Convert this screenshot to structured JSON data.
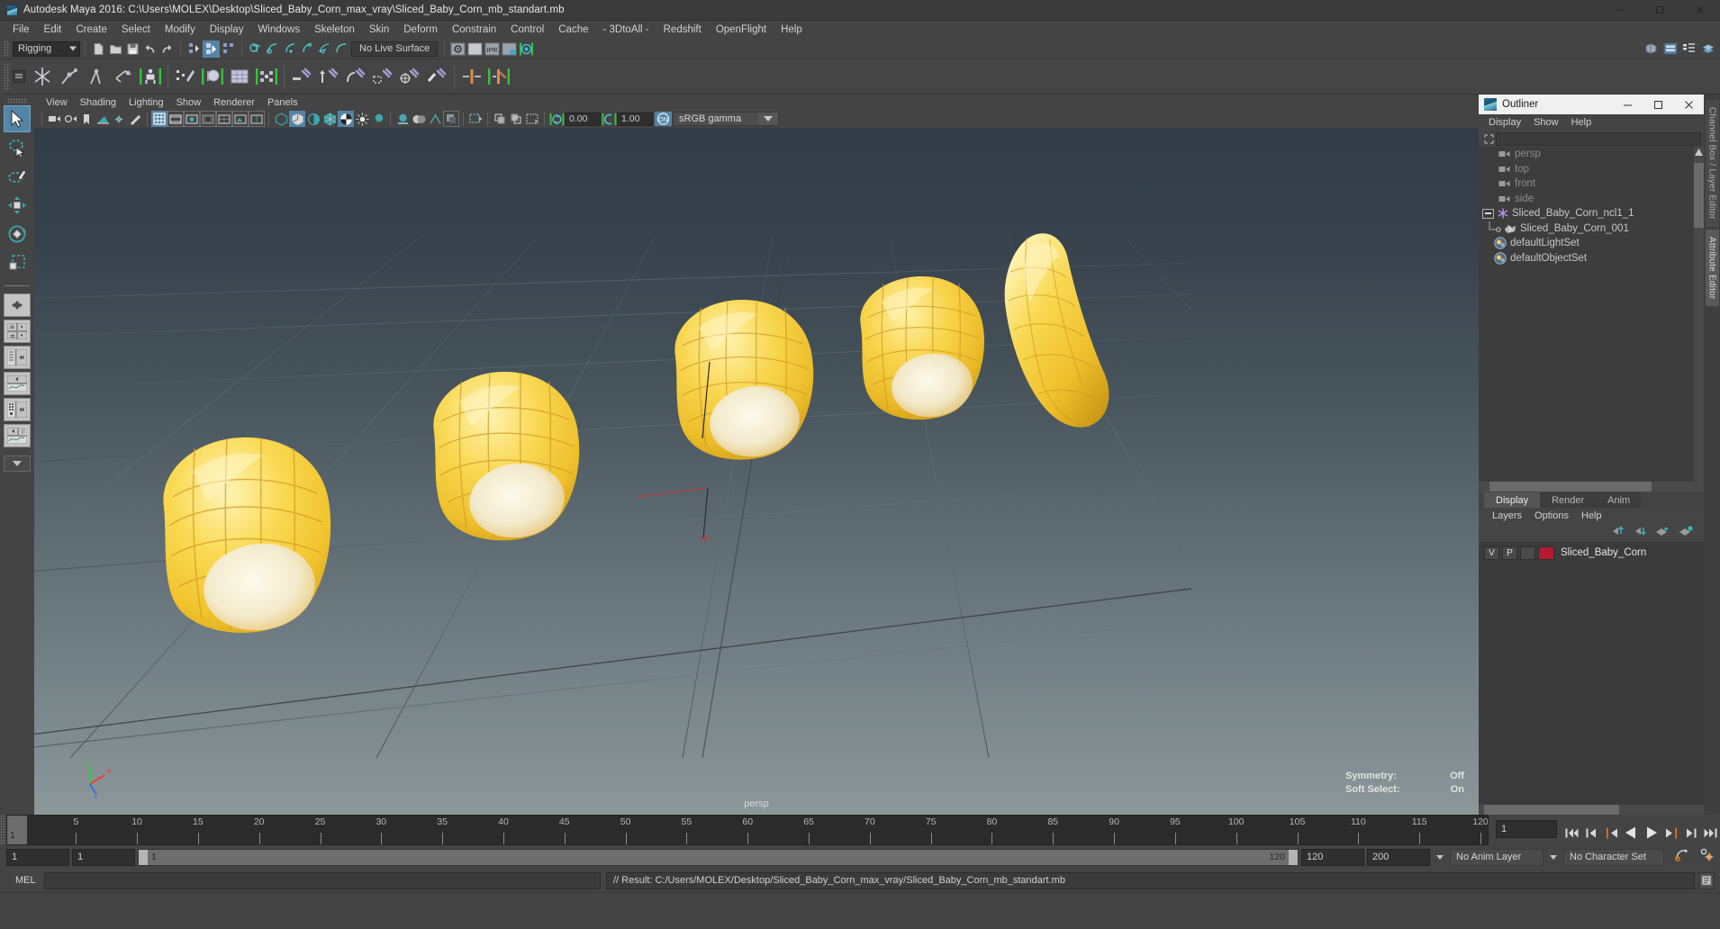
{
  "window": {
    "title": "Autodesk Maya 2016: C:\\Users\\MOLEX\\Desktop\\Sliced_Baby_Corn_max_vray\\Sliced_Baby_Corn_mb_standart.mb",
    "icon": "maya-app-icon",
    "minimize": "minimize-button",
    "maximize": "maximize-button",
    "close": "close-button"
  },
  "menubar": {
    "items": [
      "File",
      "Edit",
      "Create",
      "Select",
      "Modify",
      "Display",
      "Windows",
      "Skeleton",
      "Skin",
      "Deform",
      "Constrain",
      "Control",
      "Cache",
      "- 3DtoAll -",
      "Redshift",
      "OpenFlight",
      "Help"
    ]
  },
  "statusline": {
    "menu_set": "Rigging",
    "live_surface": "No Live Surface"
  },
  "viewport_menu": {
    "items": [
      "View",
      "Shading",
      "Lighting",
      "Show",
      "Renderer",
      "Panels"
    ]
  },
  "viewport_toolbar": {
    "exposure_value": "0.00",
    "gamma_value": "1.00",
    "color_profile": "sRGB gamma",
    "toggle_label": "ON"
  },
  "viewport": {
    "camera_label": "persp",
    "symmetry_label": "Symmetry:",
    "symmetry_value": "Off",
    "soft_select_label": "Soft Select:",
    "soft_select_value": "On",
    "axis": {
      "x": "x",
      "y": "y",
      "z": "z"
    },
    "background_top": "#313c46",
    "background_bottom": "#8b9799"
  },
  "outliner": {
    "title": "Outliner",
    "menu": [
      "Display",
      "Show",
      "Help"
    ],
    "search_value": "",
    "search_placeholder": "",
    "items": [
      {
        "label": "persp",
        "icon": "camera-icon",
        "indent": 22,
        "dim": true
      },
      {
        "label": "top",
        "icon": "camera-icon",
        "indent": 22,
        "dim": true
      },
      {
        "label": "front",
        "icon": "camera-icon",
        "indent": 22,
        "dim": true
      },
      {
        "label": "side",
        "icon": "camera-icon",
        "indent": 22,
        "dim": true
      },
      {
        "label": "Sliced_Baby_Corn_ncl1_1",
        "icon": "transform-star-icon",
        "indent": 8,
        "dim": false,
        "expander": "minus"
      },
      {
        "label": "Sliced_Baby_Corn_001",
        "icon": "mesh-icon",
        "indent": 30,
        "dim": false
      },
      {
        "label": "defaultLightSet",
        "icon": "set-icon",
        "indent": 18,
        "dim": false
      },
      {
        "label": "defaultObjectSet",
        "icon": "set-icon",
        "indent": 18,
        "dim": false
      }
    ]
  },
  "layer_editor": {
    "tabs": [
      "Display",
      "Render",
      "Anim"
    ],
    "active_tab": "Display",
    "menu": [
      "Layers",
      "Options",
      "Help"
    ],
    "tool_icons": [
      "move-layer-up-icon",
      "move-layer-down-icon",
      "new-layer-icon",
      "new-layer-from-selected-icon"
    ],
    "layers": [
      {
        "visibility": "V",
        "playback": "P",
        "type": "",
        "color": "#b31b33",
        "name": "Sliced_Baby_Corn"
      }
    ]
  },
  "right_tabs": {
    "items": [
      "Channel Box / Layer Editor",
      "Attribute Editor"
    ],
    "active": "Attribute Editor"
  },
  "timeline": {
    "ticks": [
      5,
      10,
      15,
      20,
      25,
      30,
      35,
      40,
      45,
      50,
      55,
      60,
      65,
      70,
      75,
      80,
      85,
      90,
      95,
      100,
      105,
      110,
      115,
      120
    ],
    "current_frame": "1",
    "current_frame_field": "1",
    "playback_buttons": [
      "go-to-start-icon",
      "step-back-keyframe-icon",
      "step-back-frame-icon",
      "play-backwards-icon",
      "play-forwards-icon",
      "step-forward-frame-icon",
      "step-forward-keyframe-icon",
      "go-to-end-icon"
    ]
  },
  "range_slider": {
    "start_field": "1",
    "end_field": "1",
    "range_start": "1",
    "range_end": "120",
    "anim_end": "120",
    "playback_end": "200",
    "anim_layer": "No Anim Layer",
    "character_set": "No Character Set",
    "auto_key_icon": "auto-keyframe-icon",
    "prefs_icon": "animation-preferences-icon"
  },
  "command_line": {
    "language": "MEL",
    "input_value": "",
    "result": "// Result: C:/Users/MOLEX/Desktop/Sliced_Baby_Corn_max_vray/Sliced_Baby_Corn_mb_standart.mb"
  },
  "toolbox": {
    "items": [
      "select-tool",
      "lasso-select-tool",
      "paint-select-tool",
      "move-tool",
      "rotate-tool",
      "scale-tool"
    ],
    "active": "select-tool",
    "layouts": [
      "single-perspective-layout",
      "four-view-layout",
      "outliner-persp-layout",
      "persp-graph-layout",
      "hypershade-persp-layout",
      "persp-graph-outliner-layout"
    ]
  },
  "colors": {
    "accent_blue": "#5285a6",
    "teal_icon": "#2aa8b0",
    "shelf_green": "#39c13a",
    "layer_red": "#b31b33",
    "corn_yellow": "#f5cf3f",
    "corn_core": "#f3efe0"
  },
  "chart_data": null
}
